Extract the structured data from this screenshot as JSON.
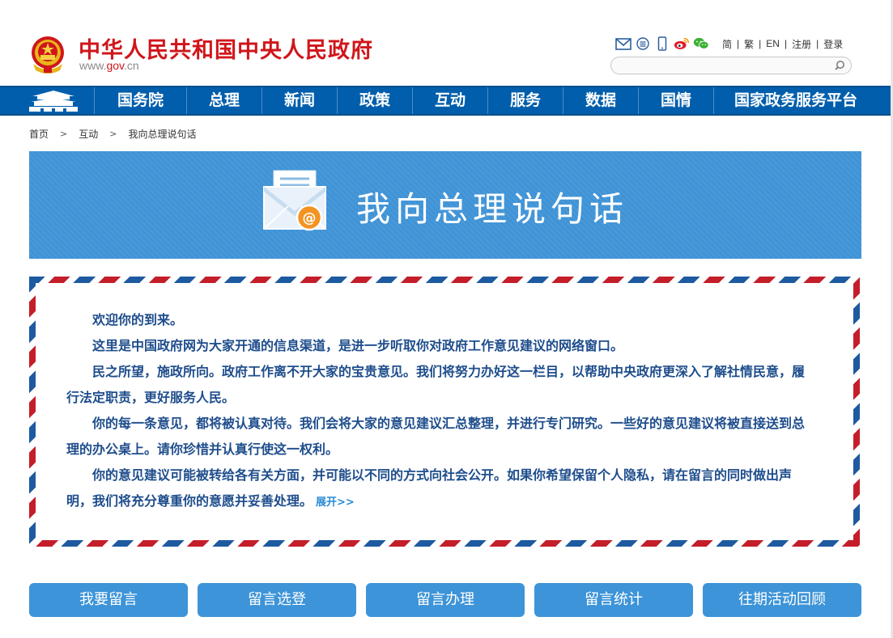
{
  "header": {
    "site_title": "中华人民共和国中央人民政府",
    "domain_prefix": "www.",
    "domain_brand": "gov",
    "domain_suffix": ".cn",
    "tools": [
      {
        "icon": "mail-icon"
      },
      {
        "icon": "rss-icon"
      },
      {
        "icon": "mobile-icon"
      },
      {
        "icon": "weibo-icon"
      },
      {
        "icon": "wechat-icon"
      }
    ],
    "links": [
      "简",
      "繁",
      "EN",
      "注册",
      "登录"
    ],
    "search": {
      "placeholder": ""
    }
  },
  "nav": {
    "home_icon": "tiananmen-icon",
    "items": [
      "国务院",
      "总理",
      "新闻",
      "政策",
      "互动",
      "服务",
      "数据",
      "国情",
      "国家政务服务平台"
    ]
  },
  "breadcrumb": [
    "首页",
    "互动",
    "我向总理说句话"
  ],
  "banner": {
    "icon": "envelope-at-icon",
    "title": "我向总理说句话"
  },
  "intro": {
    "paragraphs": [
      "欢迎你的到来。",
      "这里是中国政府网为大家开通的信息渠道，是进一步听取你对政府工作意见建议的网络窗口。",
      "民之所望，施政所向。政府工作离不开大家的宝贵意见。我们将努力办好这一栏目，以帮助中央政府更深入了解社情民意，履行法定职责，更好服务人民。",
      "你的每一条意见，都将被认真对待。我们会将大家的意见建议汇总整理，并进行专门研究。一些好的意见建议将被直接送到总理的办公桌上。请你珍惜并认真行使这一权利。",
      "你的意见建议可能被转给各有关方面，并可能以不同的方式向社会公开。如果你希望保留个人隐私，请在留言的同时做出声明，我们将充分尊重你的意愿并妥善处理。"
    ],
    "expand_label": "展开>>"
  },
  "actions": [
    "我要留言",
    "留言选登",
    "留言办理",
    "留言统计",
    "往期活动回顾"
  ],
  "colors": {
    "brand_red": "#d0161b",
    "nav_blue": "#005eac",
    "banner_blue": "#3f93d6",
    "text_blue": "#1e4d8c",
    "button_blue": "#3d94d8",
    "envelope_red": "#c41e2a",
    "envelope_blue": "#1e5aa0"
  }
}
